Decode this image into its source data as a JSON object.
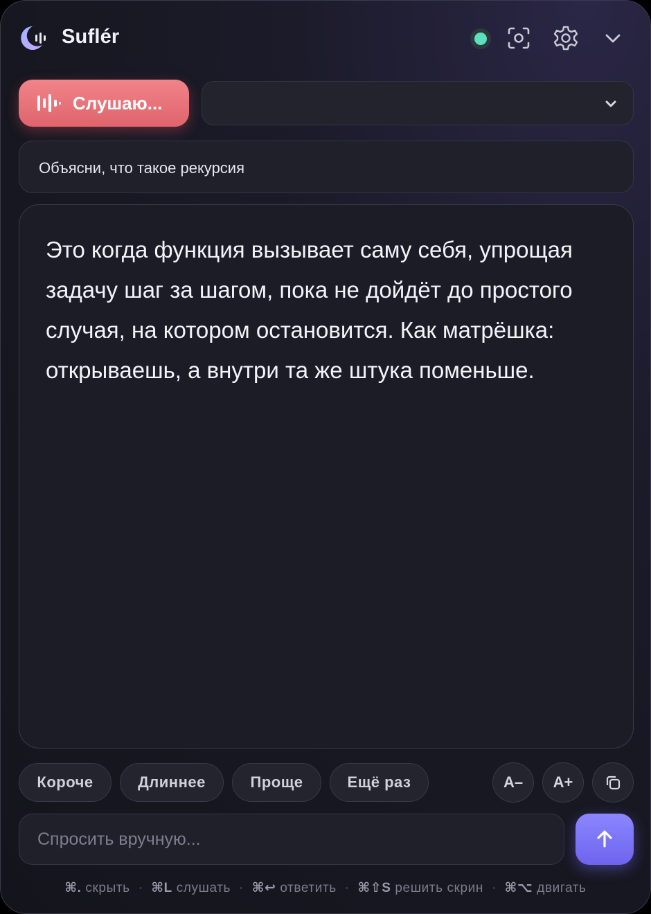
{
  "app": {
    "title": "Suflér",
    "status_color": "#5de0bd"
  },
  "header": {
    "icons": [
      "status-dot",
      "screenshot-icon",
      "gear-icon",
      "chevron-down-icon"
    ]
  },
  "listen": {
    "label": "Слушаю...",
    "icon": "waveform-icon"
  },
  "source_select": {
    "value": ""
  },
  "transcript": {
    "text": "Объясни, что такое рекурсия"
  },
  "answer": {
    "text": "Это когда функция вызывает саму себя, упрощая задачу шаг за шагом, пока не дойдёт до простого случая, на котором остановится. Как матрёшка: открываешь, а внутри та же штука поменьше."
  },
  "actions": {
    "shorter": "Короче",
    "longer": "Длиннее",
    "simpler": "Проще",
    "again": "Ещё раз",
    "font_smaller": "A–",
    "font_larger": "A+"
  },
  "ask": {
    "placeholder": "Спросить вручную...",
    "value": ""
  },
  "shortcuts": [
    {
      "key": "⌘.",
      "label": "скрыть"
    },
    {
      "key": "⌘L",
      "label": "слушать"
    },
    {
      "key": "⌘↩",
      "label": "ответить"
    },
    {
      "key": "⌘⇧S",
      "label": "решить скрин"
    },
    {
      "key": "⌘⌥",
      "label": "двигать"
    }
  ]
}
